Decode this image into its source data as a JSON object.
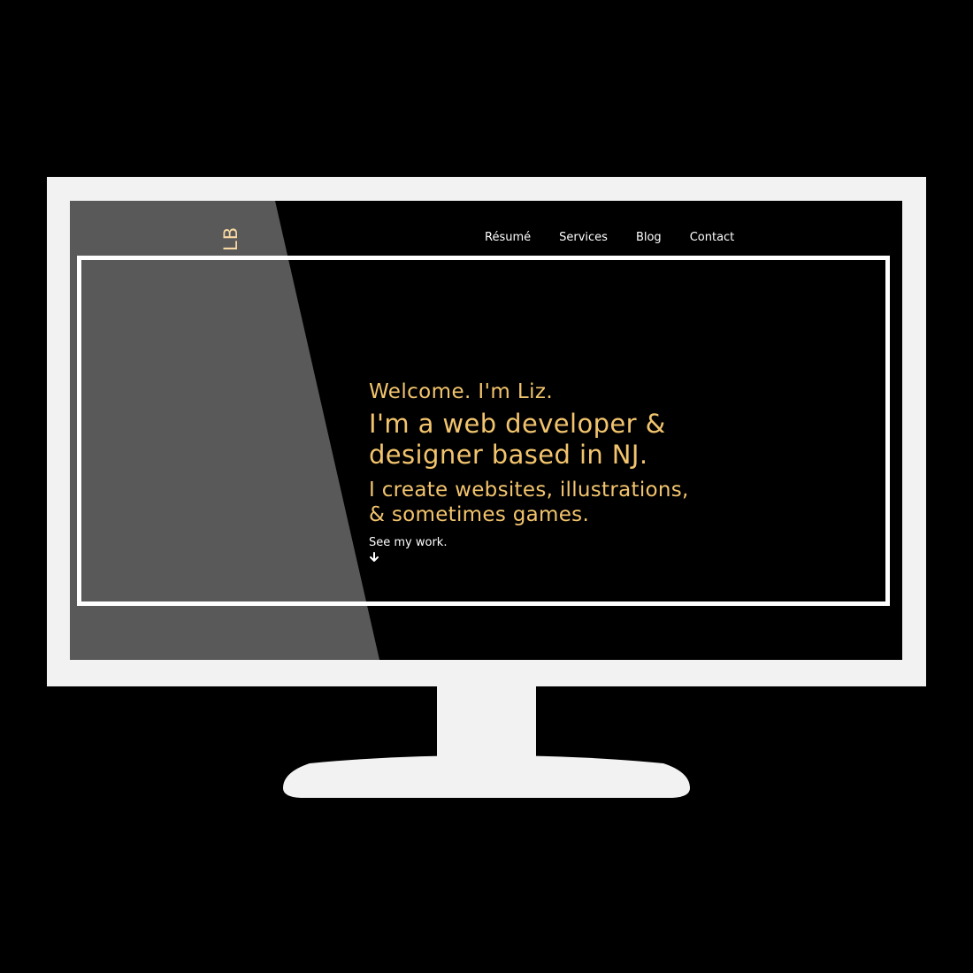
{
  "logo": {
    "text": "LB"
  },
  "nav": {
    "items": [
      {
        "label": "Résumé"
      },
      {
        "label": "Services"
      },
      {
        "label": "Blog"
      },
      {
        "label": "Contact"
      }
    ]
  },
  "hero": {
    "welcome": "Welcome. I'm Liz.",
    "tagline_line1": "I'm a web developer &",
    "tagline_line2": "designer based in NJ.",
    "subline_line1": "I create websites, illustrations,",
    "subline_line2": "& sometimes games.",
    "cta": "See my work.",
    "cta_icon": "arrow-down-icon"
  },
  "colors": {
    "accent": "#f2c46d",
    "background": "#000000",
    "frame": "#ffffff",
    "monitor": "#f2f2f2"
  }
}
